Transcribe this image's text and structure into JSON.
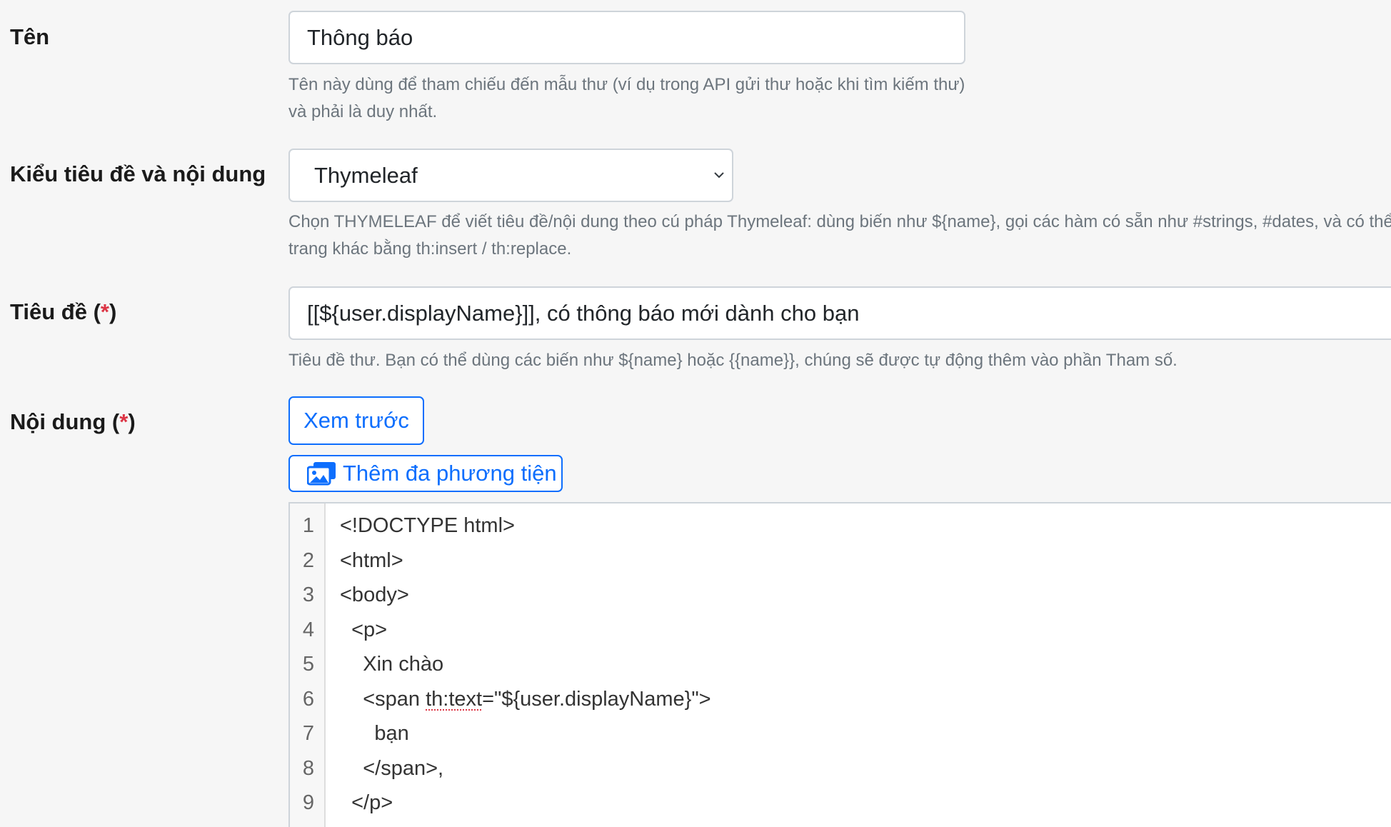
{
  "fields": {
    "name": {
      "label": "Tên",
      "value": "Thông báo",
      "help_line1": "Tên này dùng để tham chiếu đến mẫu thư (ví dụ trong API gửi thư hoặc khi tìm kiếm thư)",
      "help_line2": "và phải là duy nhất."
    },
    "content_type": {
      "label": "Kiểu tiêu đề và nội dung",
      "selected": "Thymeleaf",
      "help_line1": "Chọn THYMELEAF để viết tiêu đề/nội dung theo cú pháp Thymeleaf: dùng biến như ${name}, gọi các hàm có sẵn như #strings, #dates, và có thể tận",
      "help_line2": "trang khác bằng th:insert / th:replace."
    },
    "subject": {
      "label": "Tiêu đề (",
      "required_mark": "*",
      "label_close": ")",
      "value": "[[${user.displayName}]], có thông báo mới dành cho bạn",
      "help": "Tiêu đề thư. Bạn có thể dùng các biến như ${name} hoặc {{name}}, chúng sẽ được tự động thêm vào phần Tham số."
    },
    "body": {
      "label": "Nội dung (",
      "required_mark": "*",
      "label_close": ")",
      "preview_button": "Xem trước",
      "add_media_button": "Thêm đa phương tiện"
    }
  },
  "editor": {
    "lines": [
      {
        "no": "1",
        "text": "<!DOCTYPE html>"
      },
      {
        "no": "2",
        "text": "<html>"
      },
      {
        "no": "3",
        "text": "<body>"
      },
      {
        "no": "4",
        "text": "  <p>"
      },
      {
        "no": "5",
        "text": "    Xin chào"
      },
      {
        "no": "6",
        "pre": "    <span ",
        "flagged": "th:text",
        "post": "=\"${user.displayName}\">"
      },
      {
        "no": "7",
        "text": "      bạn"
      },
      {
        "no": "8",
        "text": "    </span>,"
      },
      {
        "no": "9",
        "text": "  </p>"
      }
    ]
  },
  "colors": {
    "accent": "#0d6efd",
    "required": "#dc3545",
    "help_text": "#6c757d"
  },
  "icons": {
    "select_arrow": "chevron-down-icon",
    "media": "media-images-icon"
  }
}
